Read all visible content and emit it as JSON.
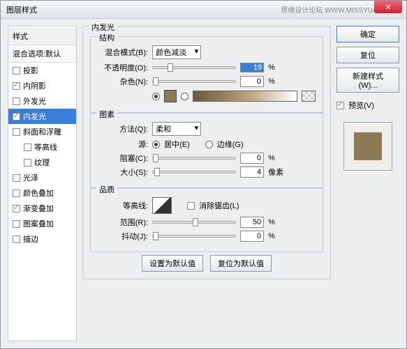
{
  "window": {
    "title": "图层样式",
    "watermark": "思缘设计论坛  WWW.MISSYUAN.COM"
  },
  "left": {
    "header": "样式",
    "sub": "混合选项:默认",
    "items": [
      {
        "label": "投影",
        "checked": false,
        "indent": false
      },
      {
        "label": "内阴影",
        "checked": true,
        "indent": false
      },
      {
        "label": "外发光",
        "checked": false,
        "indent": false
      },
      {
        "label": "内发光",
        "checked": true,
        "indent": false,
        "selected": true
      },
      {
        "label": "斜面和浮雕",
        "checked": false,
        "indent": false
      },
      {
        "label": "等高线",
        "checked": false,
        "indent": true
      },
      {
        "label": "纹理",
        "checked": false,
        "indent": true
      },
      {
        "label": "光泽",
        "checked": false,
        "indent": false
      },
      {
        "label": "颜色叠加",
        "checked": false,
        "indent": false
      },
      {
        "label": "渐变叠加",
        "checked": true,
        "indent": false
      },
      {
        "label": "图案叠加",
        "checked": false,
        "indent": false
      },
      {
        "label": "描边",
        "checked": false,
        "indent": false
      }
    ]
  },
  "groups": {
    "main_title": "内发光",
    "struct": {
      "legend": "结构",
      "blend_lbl": "混合模式(B):",
      "blend_val": "颜色减淡",
      "opacity_lbl": "不透明度(O):",
      "opacity_val": "19",
      "opacity_unit": "%",
      "noise_lbl": "杂色(N):",
      "noise_val": "0",
      "noise_unit": "%",
      "color": "#8b7a55"
    },
    "elem": {
      "legend": "图素",
      "method_lbl": "方法(Q):",
      "method_val": "柔和",
      "src_lbl": "源:",
      "src_center": "居中(E)",
      "src_edge": "边缘(G)",
      "choke_lbl": "阻塞(C):",
      "choke_val": "0",
      "choke_unit": "%",
      "size_lbl": "大小(S):",
      "size_val": "4",
      "size_unit": "像素"
    },
    "qual": {
      "legend": "品质",
      "contour_lbl": "等高线:",
      "aa_lbl": "消除锯齿(L)",
      "range_lbl": "范围(R):",
      "range_val": "50",
      "range_unit": "%",
      "jitter_lbl": "抖动(J):",
      "jitter_val": "0",
      "jitter_unit": "%"
    }
  },
  "buttons": {
    "set_default": "设置为默认值",
    "reset_default": "复位为默认值",
    "ok": "确定",
    "cancel": "复位",
    "newstyle": "新建样式(W)...",
    "preview": "预览(V)"
  }
}
